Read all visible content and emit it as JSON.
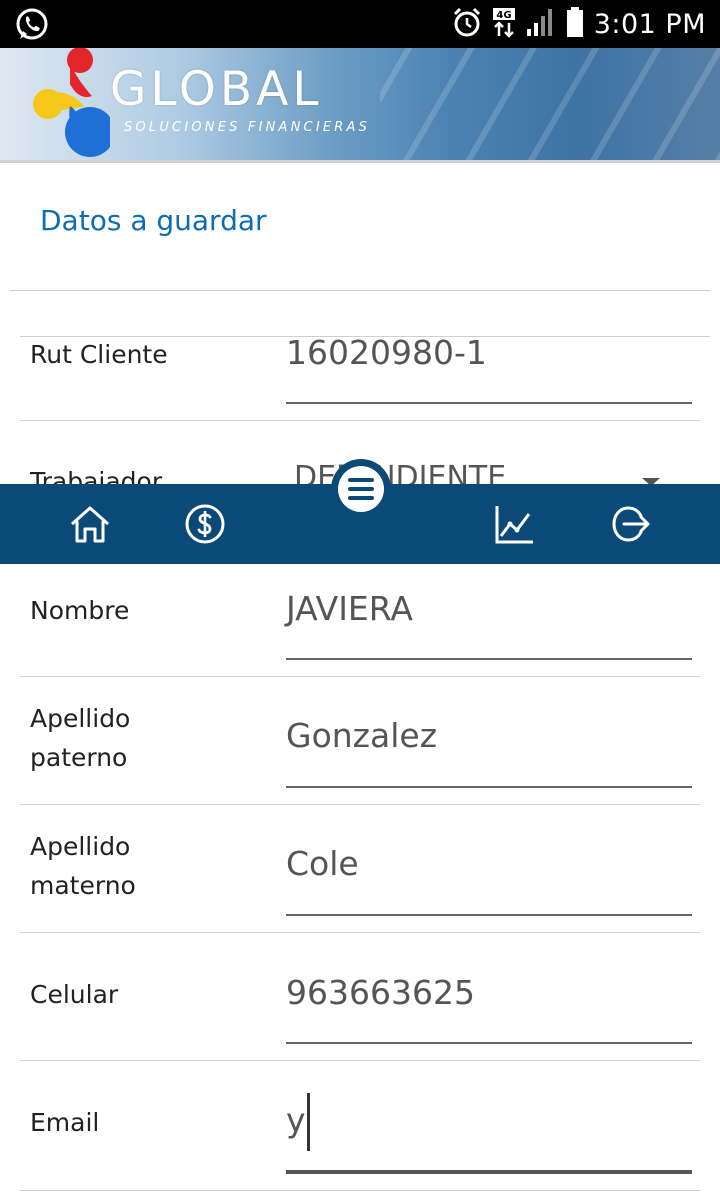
{
  "status_bar": {
    "time": "3:01 PM",
    "network": "4G",
    "icons": [
      "whatsapp-icon",
      "alarm-icon",
      "4g-data-icon",
      "signal-icon",
      "battery-icon"
    ]
  },
  "header": {
    "brand_name": "GLOBAL",
    "brand_tagline": "SOLUCIONES FINANCIERAS"
  },
  "form": {
    "section_title": "Datos a guardar",
    "fields": [
      {
        "label": "Rut Cliente",
        "value": "16020980-1"
      },
      {
        "label": "Trabajador",
        "value": "DEPENDIENTE"
      },
      {
        "label": "Nombre",
        "value": "JAVIERA"
      },
      {
        "label": "Apellido paterno",
        "value": "Gonzalez"
      },
      {
        "label": "Apellido materno",
        "value": "Cole"
      },
      {
        "label": "Celular",
        "value": "963663625"
      },
      {
        "label": "Email",
        "value": "y"
      }
    ]
  },
  "bottom_nav": {
    "items": [
      "home-icon",
      "dollar-icon",
      "menu-icon",
      "chart-icon",
      "logout-icon"
    ]
  },
  "colors": {
    "accent": "#0d6cb5",
    "nav_background": "#0b4a78",
    "status_bar": "#000000"
  }
}
